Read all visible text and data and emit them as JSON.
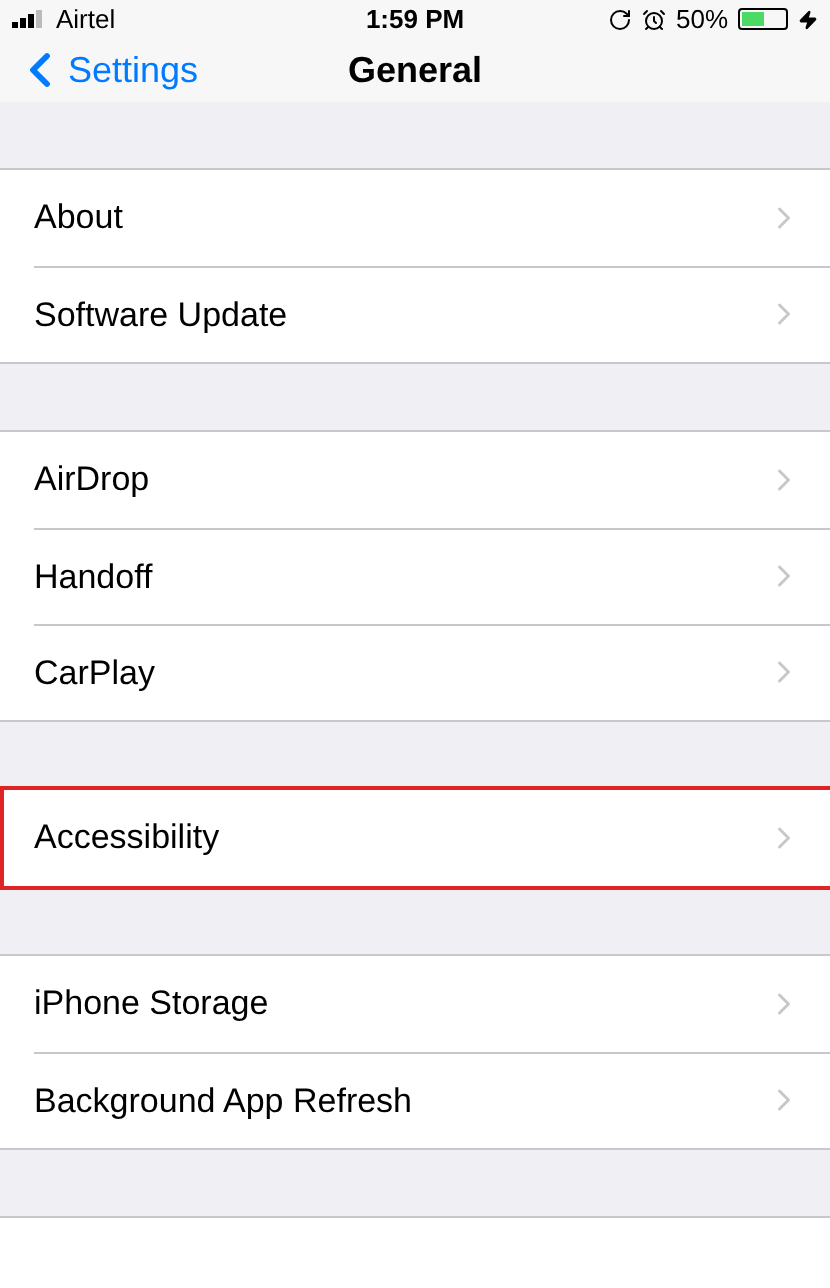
{
  "status_bar": {
    "carrier": "Airtel",
    "time": "1:59 PM",
    "battery": "50%"
  },
  "nav": {
    "back": "Settings",
    "title": "General"
  },
  "groups": [
    {
      "rows": [
        {
          "label": "About",
          "highlighted": false
        },
        {
          "label": "Software Update",
          "highlighted": false
        }
      ]
    },
    {
      "rows": [
        {
          "label": "AirDrop",
          "highlighted": false
        },
        {
          "label": "Handoff",
          "highlighted": false
        },
        {
          "label": "CarPlay",
          "highlighted": false
        }
      ]
    },
    {
      "rows": [
        {
          "label": "Accessibility",
          "highlighted": true
        }
      ]
    },
    {
      "rows": [
        {
          "label": "iPhone Storage",
          "highlighted": false
        },
        {
          "label": "Background App Refresh",
          "highlighted": false
        }
      ]
    }
  ]
}
